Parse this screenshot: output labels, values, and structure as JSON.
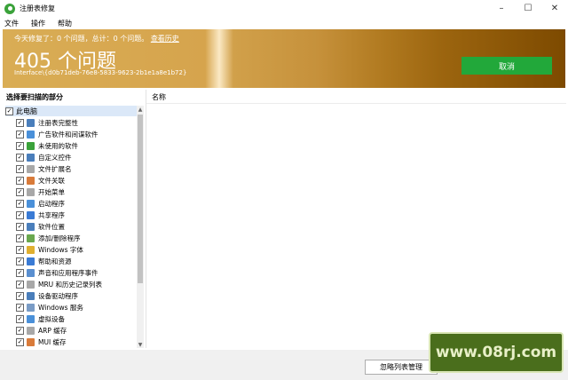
{
  "window": {
    "title": "注册表修复",
    "controls": [
      "–",
      "☐",
      "✕"
    ]
  },
  "menu": {
    "items": [
      "文件",
      "操作",
      "帮助"
    ]
  },
  "banner": {
    "stats_prefix": "今天修复了：0 个问题，总计：0 个问题。",
    "history_link": "查看历史",
    "problem_count": "405 个问题",
    "interface_path": "Interface\\{d0b71deb-76e8-5833-9623-2b1e1a8e1b72}",
    "cancel_button": "取消"
  },
  "left_panel": {
    "header": "选择要扫描的部分",
    "root": "此电脑",
    "items": [
      {
        "label": "注册表完整性",
        "icon": "registry-icon",
        "color": "#4a7ebb"
      },
      {
        "label": "广告软件和间谍软件",
        "icon": "adware-icon",
        "color": "#4a90d9"
      },
      {
        "label": "未使用的软件",
        "icon": "trash-icon",
        "color": "#3aa23a"
      },
      {
        "label": "自定义控件",
        "icon": "control-icon",
        "color": "#4a7ebb"
      },
      {
        "label": "文件扩展名",
        "icon": "file-icon",
        "color": "#a8a8a8"
      },
      {
        "label": "文件关联",
        "icon": "file-assoc-icon",
        "color": "#d97b3a"
      },
      {
        "label": "开始菜单",
        "icon": "start-menu-icon",
        "color": "#a8a8a8"
      },
      {
        "label": "启动程序",
        "icon": "startup-icon",
        "color": "#4a90d9"
      },
      {
        "label": "共享程序",
        "icon": "shared-icon",
        "color": "#3a7bd5"
      },
      {
        "label": "软件位置",
        "icon": "location-icon",
        "color": "#4a7ebb"
      },
      {
        "label": "添加/删除程序",
        "icon": "add-remove-icon",
        "color": "#6aa84f"
      },
      {
        "label": "Windows 字体",
        "icon": "font-icon",
        "color": "#e0b030"
      },
      {
        "label": "帮助和资源",
        "icon": "help-icon",
        "color": "#3a7bd5"
      },
      {
        "label": "声音和应用程序事件",
        "icon": "sound-icon",
        "color": "#5a8fd0"
      },
      {
        "label": "MRU 和历史记录列表",
        "icon": "history-icon",
        "color": "#a8a8a8"
      },
      {
        "label": "设备驱动程序",
        "icon": "driver-icon",
        "color": "#4a7ebb"
      },
      {
        "label": "Windows 服务",
        "icon": "service-icon",
        "color": "#7a9cc6"
      },
      {
        "label": "虚拟设备",
        "icon": "virtual-device-icon",
        "color": "#4a90d9"
      },
      {
        "label": "ARP 缓存",
        "icon": "arp-icon",
        "color": "#a8a8a8"
      },
      {
        "label": "MUI 缓存",
        "icon": "mui-icon",
        "color": "#d97b3a"
      }
    ]
  },
  "right_panel": {
    "column_name": "名称"
  },
  "bottom": {
    "ignore_button": "忽略列表管理"
  },
  "watermark": {
    "text": "www.08rj.com"
  }
}
